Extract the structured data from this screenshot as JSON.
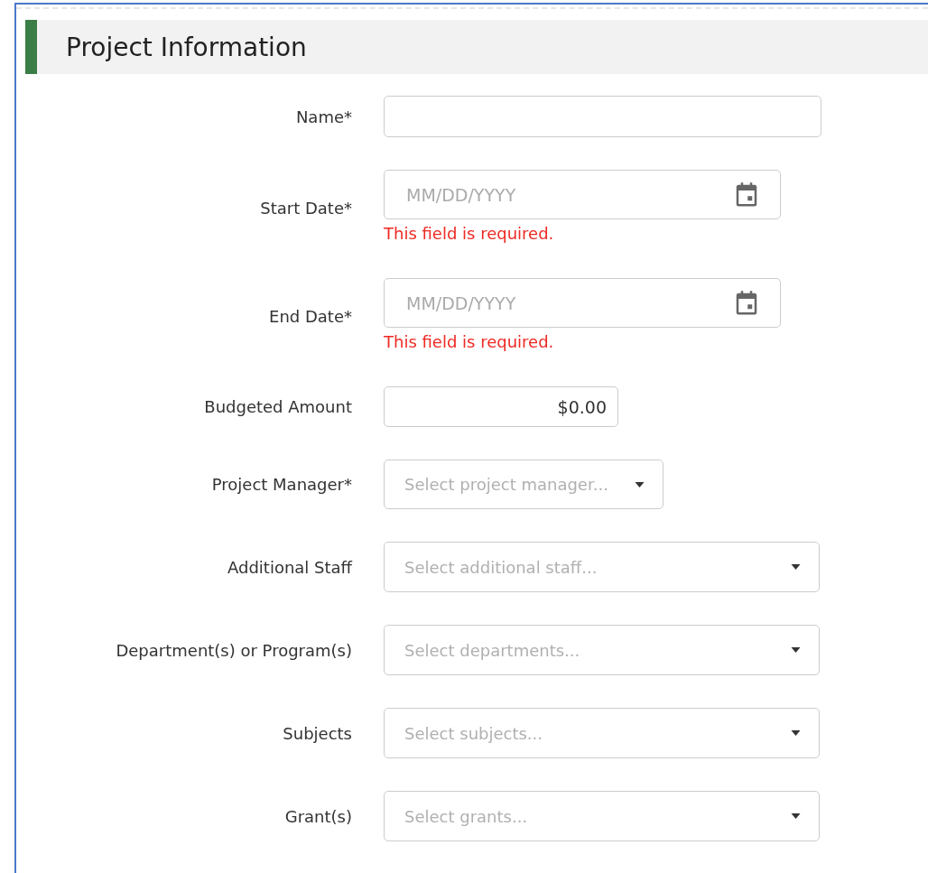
{
  "section": {
    "title": "Project Information"
  },
  "fields": [
    {
      "kind": "text",
      "label": "Name*"
    },
    {
      "kind": "date",
      "label": "Start Date*",
      "placeholder": "MM/DD/YYYY",
      "error": "This field is required."
    },
    {
      "kind": "date",
      "label": "End Date*",
      "placeholder": "MM/DD/YYYY",
      "error": "This field is required."
    },
    {
      "kind": "currency",
      "label": "Budgeted Amount",
      "value": "$0.00"
    },
    {
      "kind": "select",
      "label": "Project Manager*",
      "placeholder": "Select project manager..."
    },
    {
      "kind": "multiselect",
      "label": "Additional Staff",
      "placeholder": "Select additional staff..."
    },
    {
      "kind": "multiselect",
      "label": "Department(s) or Program(s)",
      "placeholder": "Select departments..."
    },
    {
      "kind": "multiselect",
      "label": "Subjects",
      "placeholder": "Select subjects..."
    },
    {
      "kind": "multiselect",
      "label": "Grant(s)",
      "placeholder": "Select grants..."
    }
  ]
}
